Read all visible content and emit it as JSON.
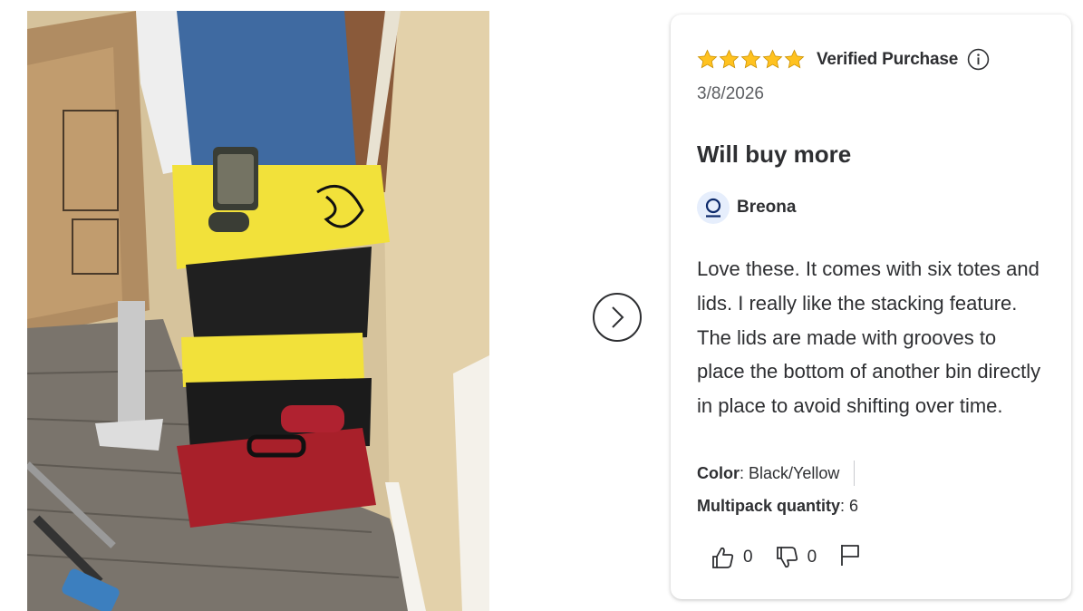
{
  "review": {
    "rating": 5,
    "rating_max": 5,
    "verified_label": "Verified Purchase",
    "date": "3/8/2026",
    "title": "Will buy more",
    "author": "Breona",
    "body": "Love these. It comes with six totes and lids. I really like the stacking feature. The lids are made with grooves to place the bottom of another bin directly in place to avoid shifting over time.",
    "attributes": {
      "color_label": "Color",
      "color_value": ": Black/Yellow",
      "multipack_label": "Multipack quantity",
      "multipack_value": ": 6"
    },
    "helpful_count": "0",
    "unhelpful_count": "0"
  },
  "icons": {
    "star": "star-icon",
    "info": "info-icon",
    "avatar": "user-icon",
    "next": "chevron-right-icon",
    "thumbs_up": "thumbs-up-icon",
    "thumbs_down": "thumbs-down-icon",
    "flag": "flag-icon"
  },
  "colors": {
    "star": "#ffc220",
    "text": "#2e2f32",
    "muted": "#5c5e62",
    "avatar_bg": "#e6eefc",
    "avatar_fg": "#0d2a6b",
    "tote_lid": "#f2e13a",
    "toolbox": "#a8202a"
  }
}
